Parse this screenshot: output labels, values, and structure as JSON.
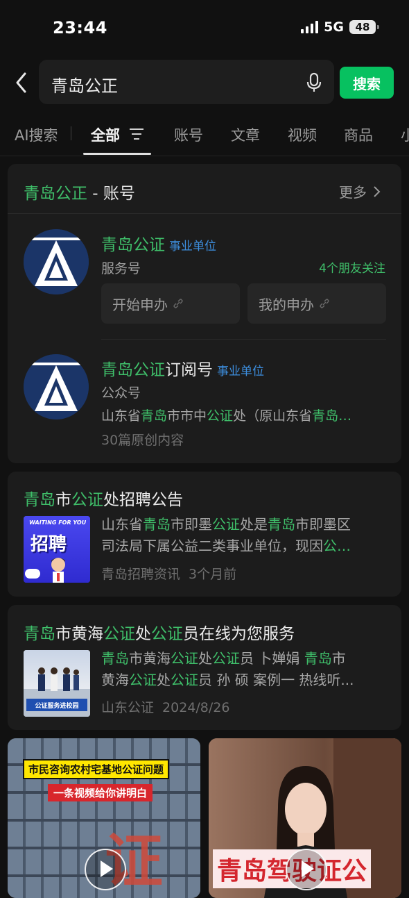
{
  "status": {
    "time": "23:44",
    "network": "5G",
    "battery": "48"
  },
  "search": {
    "query": "青岛公正",
    "button": "搜索"
  },
  "tabs": [
    "AI搜索",
    "全部",
    "账号",
    "文章",
    "视频",
    "商品",
    "小"
  ],
  "account_section": {
    "query_part": "青岛公正",
    "title_suffix": " - 账号",
    "more": "更多",
    "accounts": [
      {
        "name_hl": "青岛公证",
        "name_rest": "",
        "tag": "事业单位",
        "type": "服务号",
        "friends": "4个朋友关注",
        "actions": [
          "开始申办",
          "我的申办"
        ]
      },
      {
        "name_hl": "青岛公证",
        "name_rest": "订阅号",
        "tag": "事业单位",
        "type": "公众号",
        "desc_parts": [
          "山东省",
          "青岛",
          "市市中",
          "公证",
          "处（原山东省",
          "青岛…"
        ],
        "meta": "30篇原创内容"
      }
    ]
  },
  "articles": [
    {
      "title_parts": [
        "青岛",
        "市",
        "公证",
        "处招聘公告"
      ],
      "line1_parts": [
        "山东省",
        "青岛",
        "市即墨",
        "公证",
        "处是",
        "青岛",
        "市即墨区"
      ],
      "line2_parts": [
        "司法局下属公益二类事业单位，现因",
        "公…"
      ],
      "source": "青岛招聘资讯",
      "time": "3个月前",
      "thumb": {
        "top": "WAITING FOR YOU",
        "big": "招聘"
      }
    },
    {
      "title_parts": [
        "青岛",
        "市黄海",
        "公证",
        "处",
        "公证",
        "员在线为您服务"
      ],
      "line1_parts": [
        "青岛",
        "市黄海",
        "公证",
        "处",
        "公证",
        "员 卜婵娟 ",
        "青岛",
        "市"
      ],
      "line2_parts": [
        "黄海",
        "公证",
        "处",
        "公证",
        "员 孙 硕 案例一 热线听..."
      ],
      "source": "山东公证",
      "time": "2024/8/26",
      "thumb": {
        "banner": "公证服务进校园"
      }
    }
  ],
  "videos": [
    {
      "line1": "市民咨询农村宅基地公证问题",
      "line2": "一条视频给你讲明白",
      "bg_text": "证"
    },
    {
      "caption": "青岛驾驶证公"
    }
  ],
  "colors": {
    "accent": "#07c160",
    "highlight": "#3fbf6a",
    "tag": "#3d8fe0",
    "background": "#111111"
  }
}
